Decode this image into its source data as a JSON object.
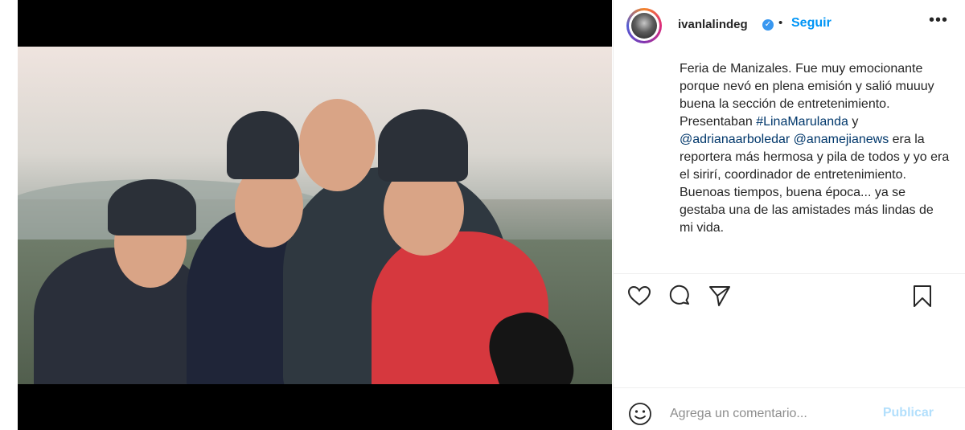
{
  "post": {
    "username": "ivanlalindeg",
    "separator": "•",
    "follow_label": "Seguir",
    "more_label": "•••",
    "verified_label": "✓"
  },
  "caption": {
    "text_1": "Feria de Manizales. Fue muy emocionante porque nevó en plena emisión y salió muuuy buena la sección de entretenimiento. Presentaban ",
    "mention_1": "#LinaMarulanda",
    "text_2": " y ",
    "mention_2": "@adrianaarboledar",
    "text_3": " ",
    "mention_3": "@anamejianews",
    "text_4": " era la reportera más hermosa y pila de todos y yo era el sirirí, coordinador de entretenimiento. Buenoas tiempos, buena época... ya se gestaba una de las amistades más lindas de mi vida."
  },
  "actions": {
    "like_icon": "heart-icon",
    "comment_icon": "comment-icon",
    "share_icon": "share-icon",
    "save_icon": "bookmark-icon"
  },
  "comment": {
    "placeholder": "Agrega un comentario...",
    "publish_label": "Publicar"
  },
  "colors": {
    "link": "#00376b",
    "follow": "#0095f6",
    "publish_disabled": "#b2dffc"
  }
}
